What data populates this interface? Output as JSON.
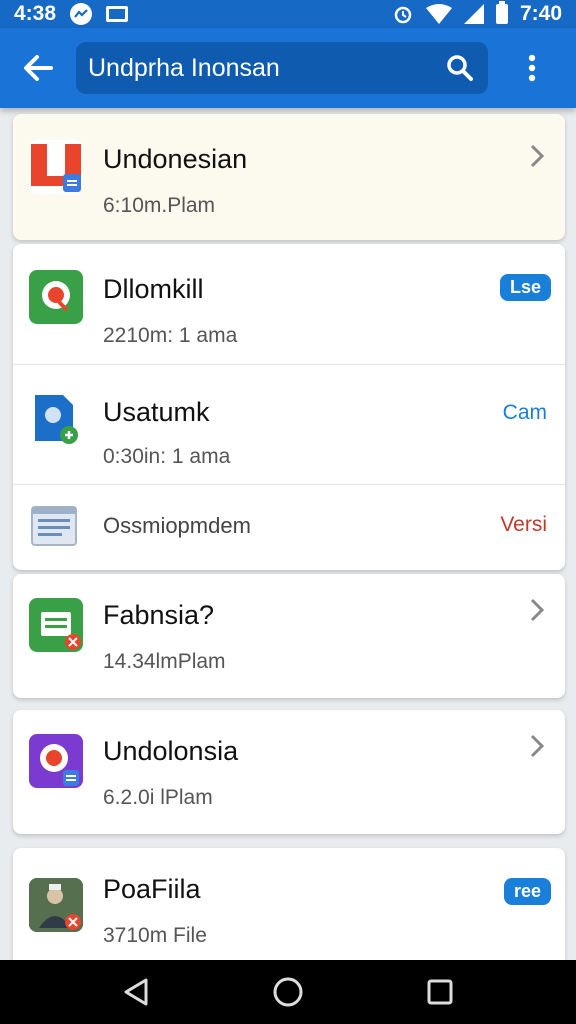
{
  "status_bar": {
    "time_left": "4:38",
    "time_right": "7:40"
  },
  "search": {
    "value": "Undprha Inonsan"
  },
  "colors": {
    "app_bar": "#1a73d6",
    "status_bar": "#1669c4",
    "badge_blue": "#1a7fd9",
    "action_blue": "#1a7fd9",
    "action_red": "#c0392b"
  },
  "items": [
    {
      "title": "Undonesian",
      "subtitle": "6:10m.Plam",
      "icon": "document-app-icon",
      "trailing": "chevron"
    },
    {
      "title": "Dllomkill",
      "subtitle": "2210m: 1 ama",
      "icon": "maps-app-icon",
      "badge": "Lse"
    },
    {
      "title": "Usatumk",
      "subtitle": "0:30in: 1 ama",
      "icon": "file-app-icon",
      "action": "Cam"
    },
    {
      "title": "Ossmiopmdem",
      "icon": "notes-app-icon",
      "action": "Versi"
    },
    {
      "title": "Fabnsia?",
      "subtitle": "14.34lmPlam",
      "icon": "sheets-app-icon",
      "trailing": "chevron"
    },
    {
      "title": "Undolonsia",
      "subtitle": "6.2.0i lPlam",
      "icon": "camera-app-icon",
      "trailing": "chevron"
    },
    {
      "title": "PoaFiila",
      "subtitle": "3710m File",
      "icon": "photo-app-icon",
      "badge": "ree"
    }
  ]
}
